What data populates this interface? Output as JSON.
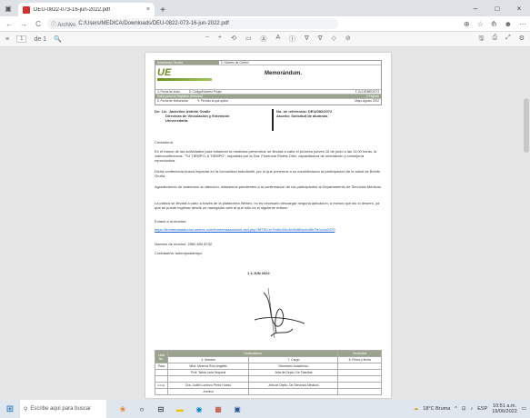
{
  "browser": {
    "tab_title": "DEU-0822-073-16-jun-2022.pdf",
    "tab_close": "×",
    "new_tab": "+",
    "win_min": "–",
    "win_max": "□",
    "win_close": "×",
    "back": "←",
    "forward": "→",
    "reload": "C",
    "info_label": "ⓘ Archivo",
    "url": "C:/Users/MEDICA/Downloads/DEU-0822-073-16-jun-2022.pdf",
    "right_icons": [
      "⊕",
      "☆",
      "⟰",
      "☻",
      "⋯"
    ]
  },
  "pdf_toolbar": {
    "menu": "≡",
    "page_num": "1",
    "page_total": "de 1",
    "search": "🔍",
    "center_icons": [
      "−",
      "+",
      "⟲",
      "▭",
      "Ⓐ",
      "A",
      "Ⓘ",
      "∇",
      "∇",
      "◇",
      "⊘"
    ],
    "right_icons": [
      "🖫",
      "⎙",
      "⤢",
      "⚙"
    ]
  },
  "document": {
    "header": {
      "row1_left": "Enseñanza Técnica",
      "row1_mid": "2. Número de Control",
      "memo_title": "Memorándum.",
      "row_a_left": "4. Fecha de inicio",
      "row_a_mid": "5. Código/Número Propio",
      "row_a_right": "F-JV-DE/MED/073",
      "dark_row": "Datos para los Registros (Módulos)",
      "row_b_right": "2 Páginas",
      "row_c_left": "8. Fecha de elaboración",
      "row_c_mid": "9. Período al que aplica",
      "row_c_right": "Mayo-Agosto 2022"
    },
    "to_label": "De:",
    "to_name": "Lic. Jackeline Aldrete Ovalle",
    "to_title1": "Directora de Vinculación y Extensión",
    "to_title2": "Universitaria.",
    "ref_label": "No. de referencia:",
    "ref_value": "DEU/082/2072",
    "subject_label": "Asunto:",
    "subject_value": "Solicitud de alumnos",
    "greeting": "Contaduría",
    "p1": "En el marco de las actividades para fortalecer la medicina preventiva, se llevará a cabo el próximo jueves 16 de junio a las 11:00 horas, la videoconferencia: \"TU TIEMPO, A TIEMPO\", impartida por la Dra. Florencia Rivera Ortiz, capacitadora de orientación y consejería reproductiva.",
    "p2": "Dicha conferencia busca impactar en la comunidad estudiantil, por lo que ponemos a su consideración la participación de la salud de Benito Oruña.",
    "p3": "Agradeciendo de antemano su atención, estaremos pendientes a la confirmación de los participantes al Departamento de Servicios Médicos.",
    "p4": "La plática se llevará a cabo a través de la plataforma Webex, no es necesario descargar ninguna aplicación, a menos que así lo desees, ya que se puede ingresar desde un navegador web al que sólo es el siguiente enlace:",
    "link_label": "Enlace a la reunión:",
    "link": "https://fronteiraaaalumni.webex.com/fronteiraaaalumni-es/j.php?MTID=m7bd0c34e3e36d80cc6d5b7fe1c0a2470",
    "meeting_num": "Número de reunión: 2550 800 8732",
    "password": "Contraseña: tutiempoatiempo",
    "stamp": "1 4 JUN 2022",
    "table": {
      "h_col1": "Lista No.",
      "h_group1": "Destinatarios",
      "h_group2": "Recibidos",
      "h_name": "4. Nombre",
      "h_cargo": "7. Cargo",
      "h_firma": "8. Firma y fecha",
      "rows": [
        {
          "no": "Para",
          "name": "Mtra. Minerva Ríos Angeles",
          "cargo": "Secretario Académico",
          "firma": ""
        },
        {
          "no": "",
          "name": "Prof. Tsilda León Mayoral",
          "cargo": "Jefa de Depto. De Fakultas",
          "firma": ""
        },
        {
          "no": "",
          "name": "",
          "cargo": "",
          "firma": ""
        },
        {
          "no": "c.c.p.",
          "name": "Dra. Judith Lorenzo Pérez Hueso",
          "cargo": "Jefa de Depto. De Servicios Médicos",
          "firma": ""
        },
        {
          "no": "",
          "name": "Archivo",
          "cargo": "",
          "firma": ""
        }
      ]
    }
  },
  "taskbar": {
    "search_placeholder": "Escribe aquí para buscar",
    "weather": "18°C Bruma",
    "language": "ESP",
    "time": "10:51 a.m.",
    "date": "16/06/2022"
  }
}
